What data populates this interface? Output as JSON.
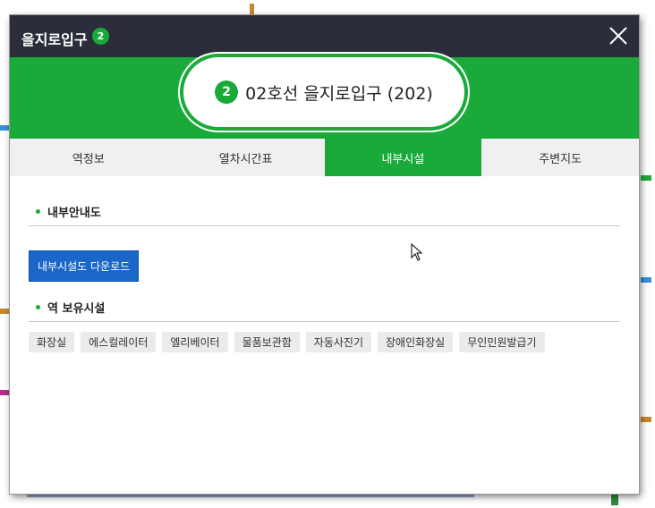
{
  "window": {
    "title": "을지로입구",
    "line_badge": "2",
    "close_icon": "close-icon"
  },
  "station": {
    "line_number": "2",
    "name": "02호선 을지로입구 (202)"
  },
  "tabs": [
    {
      "label": "역정보",
      "active": false
    },
    {
      "label": "열차시간표",
      "active": false
    },
    {
      "label": "내부시설",
      "active": true
    },
    {
      "label": "주변지도",
      "active": false
    }
  ],
  "sections": {
    "guide_title": "내부안내도",
    "download_button": "내부시설도 다운로드",
    "facilities_title": "역 보유시설"
  },
  "facilities": [
    "화장실",
    "에스컬레이터",
    "엘리베이터",
    "물품보관함",
    "자동사진기",
    "장애인화장실",
    "무인민원발급기"
  ],
  "colors": {
    "line2_green": "#1aaa3a",
    "titlebar": "#2b2d3a",
    "download_blue": "#1b67c9"
  }
}
